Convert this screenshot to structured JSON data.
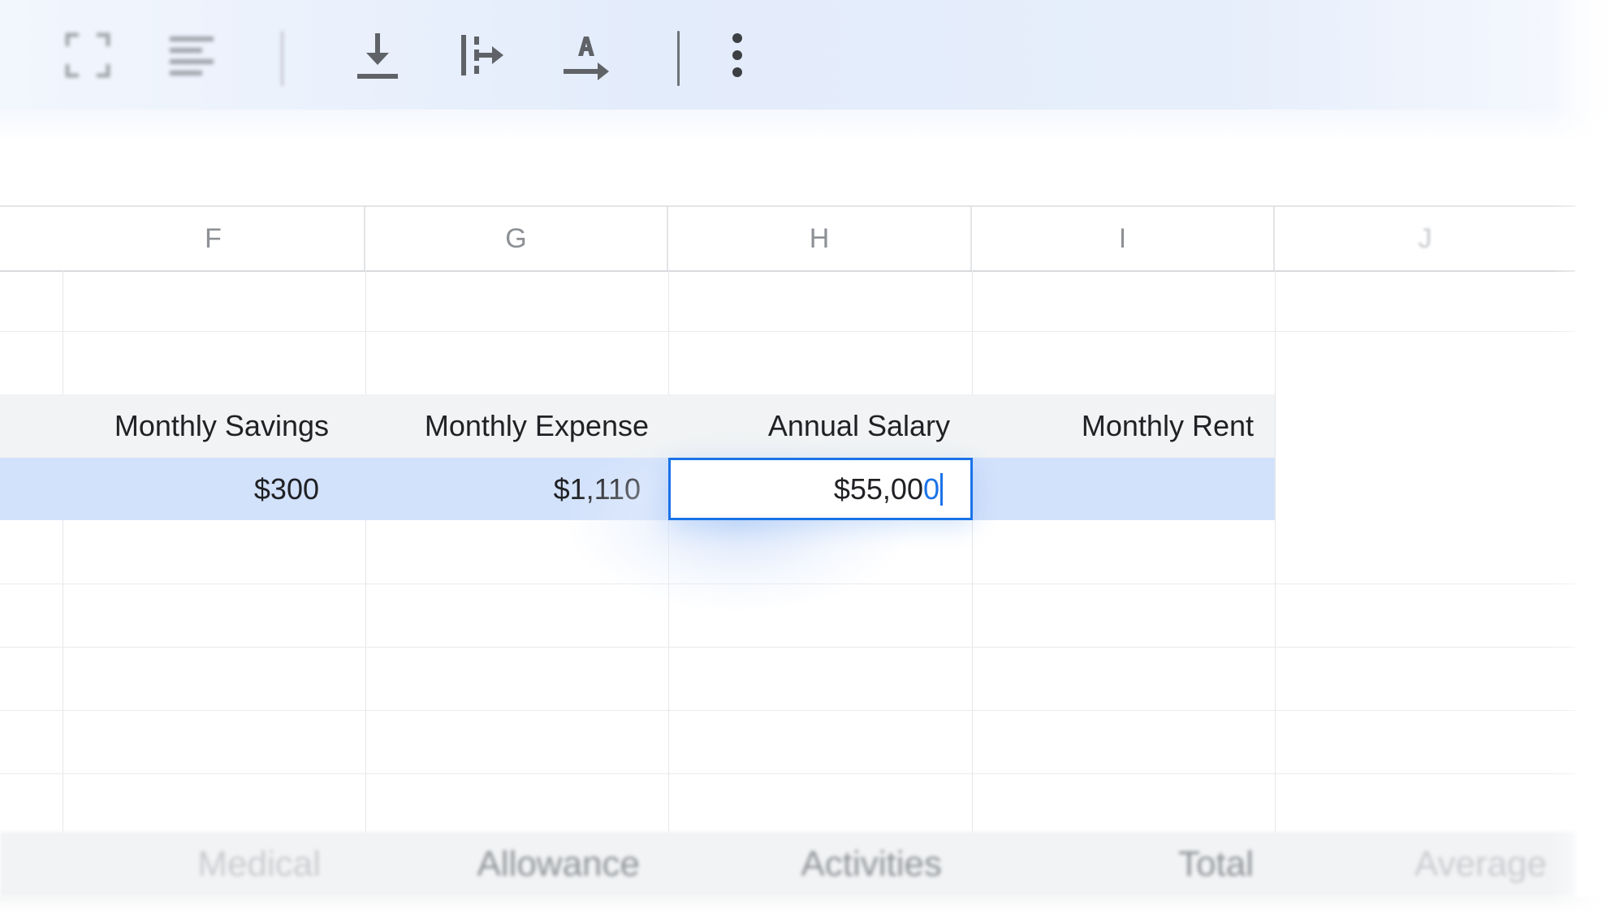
{
  "columns": [
    {
      "letter": "F"
    },
    {
      "letter": "G"
    },
    {
      "letter": "H"
    },
    {
      "letter": "I"
    },
    {
      "letter": "J"
    }
  ],
  "labels": {
    "f": "Monthly Savings",
    "g": "Monthly Expense",
    "h": "Annual Salary",
    "i": "Monthly Rent"
  },
  "values": {
    "f": "$300",
    "g": "$1,110",
    "h_editing_main": "$55,00",
    "h_editing_last": "0"
  },
  "bottom_row": {
    "f": "Medical",
    "g": "Allowance",
    "h": "Activities",
    "i": "Total",
    "j": "Average"
  },
  "toolbar_icons": [
    "fullscreen-icon",
    "align-left-icon",
    "download-icon",
    "wrap-text-icon",
    "text-rotation-icon",
    "more-vert-icon"
  ]
}
